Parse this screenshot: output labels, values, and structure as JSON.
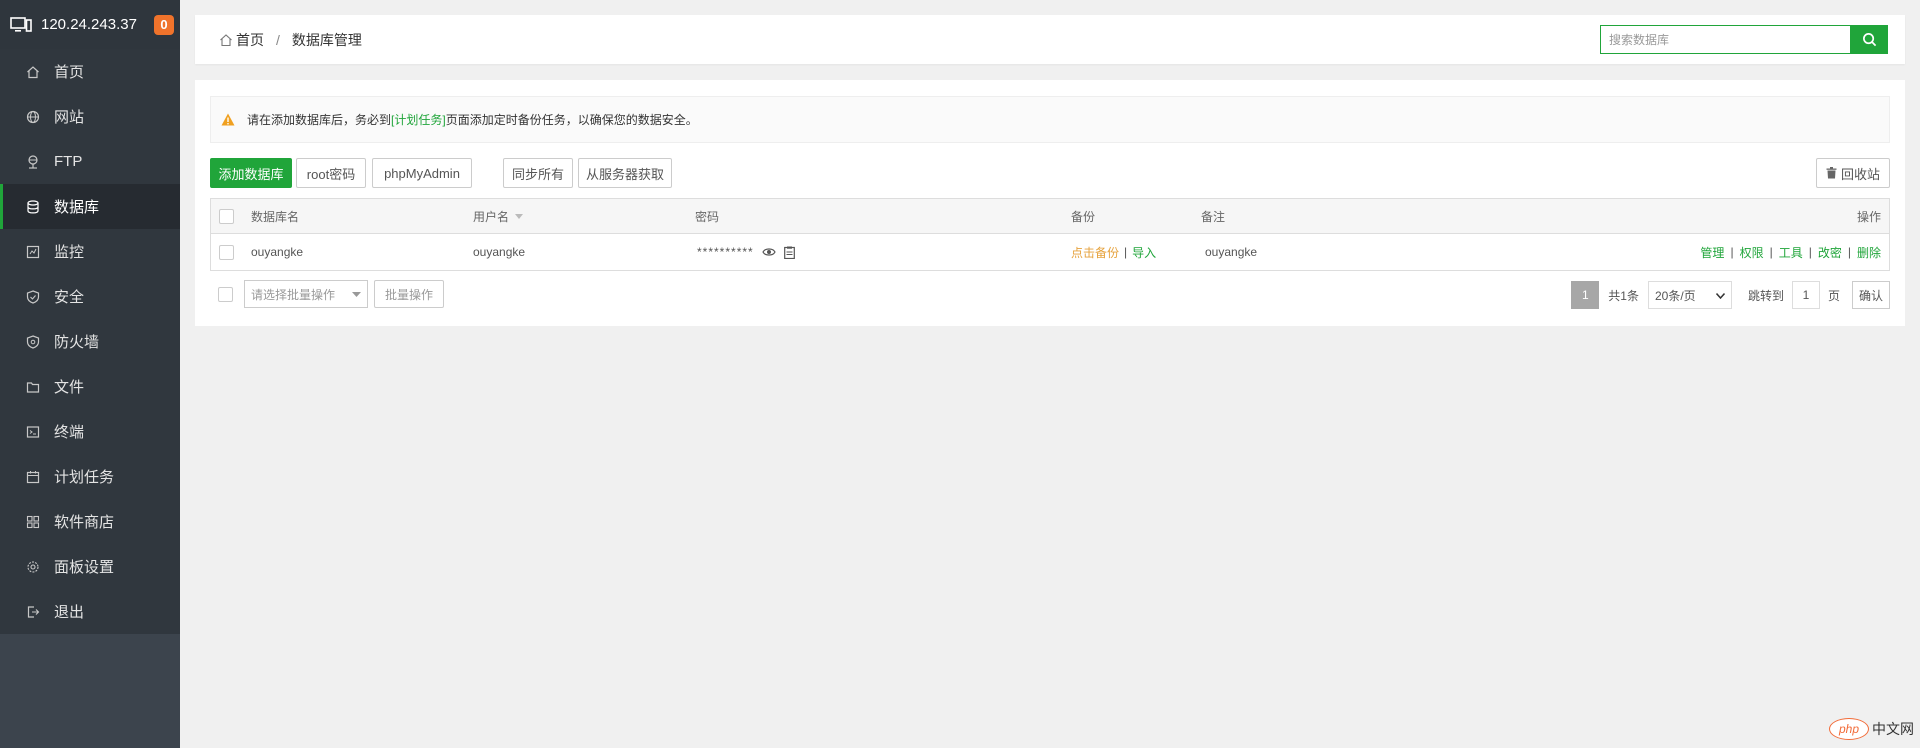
{
  "sidebar": {
    "ip": "120.24.243.37",
    "badge": "0",
    "items": [
      {
        "label": "首页",
        "icon": "home-icon"
      },
      {
        "label": "网站",
        "icon": "globe-icon"
      },
      {
        "label": "FTP",
        "icon": "ftp-icon"
      },
      {
        "label": "数据库",
        "icon": "database-icon",
        "active": true
      },
      {
        "label": "监控",
        "icon": "monitor-chart-icon"
      },
      {
        "label": "安全",
        "icon": "shield-icon"
      },
      {
        "label": "防火墙",
        "icon": "firewall-icon"
      },
      {
        "label": "文件",
        "icon": "folder-icon"
      },
      {
        "label": "终端",
        "icon": "terminal-icon"
      },
      {
        "label": "计划任务",
        "icon": "calendar-icon"
      },
      {
        "label": "软件商店",
        "icon": "apps-grid-icon"
      },
      {
        "label": "面板设置",
        "icon": "gear-icon"
      },
      {
        "label": "退出",
        "icon": "logout-icon"
      }
    ]
  },
  "header": {
    "breadcrumb_home": "首页",
    "breadcrumb_sep": "/",
    "breadcrumb_current": "数据库管理",
    "search_placeholder": "搜索数据库"
  },
  "notice": {
    "text_before": "请在添加数据库后，务必到",
    "link": "[计划任务]",
    "text_after": "页面添加定时备份任务，以确保您的数据安全。"
  },
  "toolbar": {
    "add_db": "添加数据库",
    "root_pwd": "root密码",
    "phpmyadmin": "phpMyAdmin",
    "sync_all": "同步所有",
    "fetch_server": "从服务器获取",
    "recycle": "回收站"
  },
  "table": {
    "headers": {
      "name": "数据库名",
      "user": "用户名",
      "password": "密码",
      "backup": "备份",
      "remark": "备注",
      "actions": "操作"
    },
    "rows": [
      {
        "name": "ouyangke",
        "user": "ouyangke",
        "password_mask": "**********",
        "backup_link": "点击备份",
        "backup_sep": "|",
        "import_link": "导入",
        "remark": "ouyangke",
        "actions": [
          "管理",
          "权限",
          "工具",
          "改密",
          "删除"
        ],
        "action_sep": "|"
      }
    ]
  },
  "bottom": {
    "batch_placeholder": "请选择批量操作",
    "batch_btn": "批量操作",
    "page_current": "1",
    "total": "共1条",
    "page_size": "20条/页",
    "jump_label": "跳转到",
    "jump_value": "1",
    "page_unit": "页",
    "confirm": "确认"
  },
  "watermark": {
    "php": "php",
    "text": "中文网"
  },
  "colors": {
    "accent": "#20a53a",
    "sidebar_bg": "#3c444d",
    "badge": "#f0732b",
    "backup_link": "#e6a23c"
  }
}
